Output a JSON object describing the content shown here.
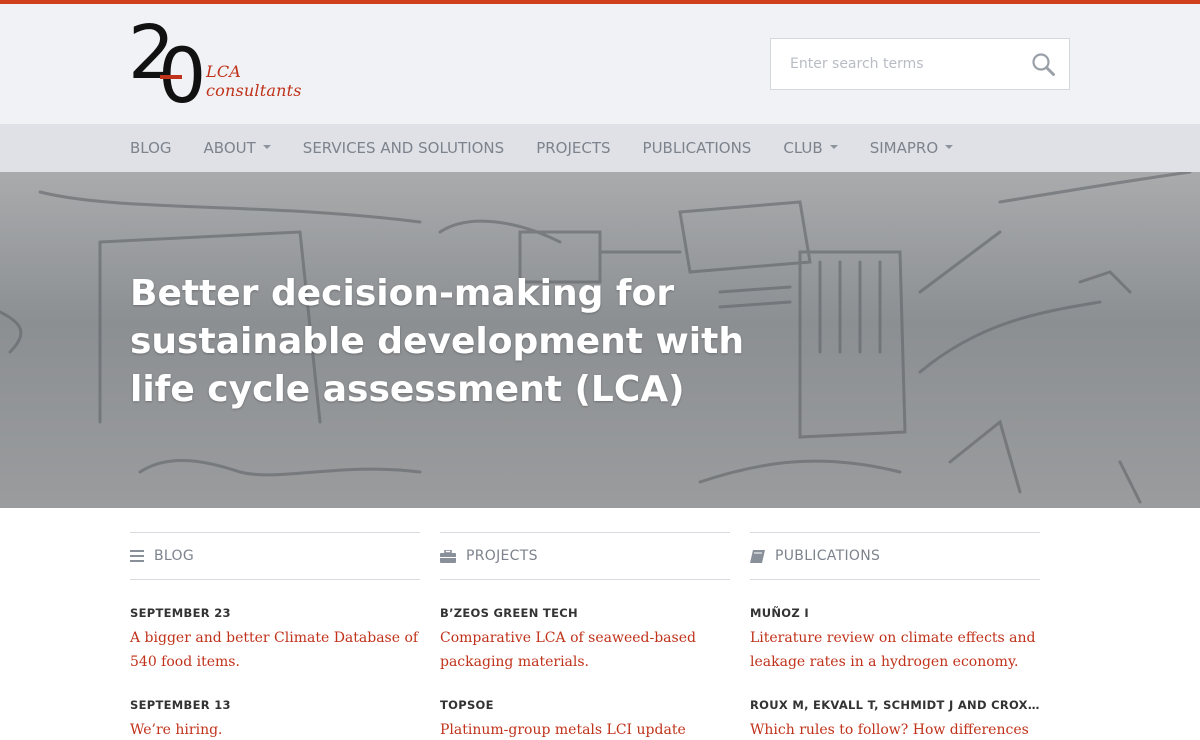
{
  "brand": {
    "logo_digit_two": "2",
    "logo_digit_zero": "0",
    "tagline": "LCA consultants",
    "accent_color": "#d0401c",
    "link_color": "#c0321a"
  },
  "search": {
    "placeholder": "Enter search terms",
    "icon": "search-icon"
  },
  "nav": {
    "items": [
      {
        "label": "BLOG",
        "dropdown": false
      },
      {
        "label": "ABOUT",
        "dropdown": true
      },
      {
        "label": "SERVICES AND SOLUTIONS",
        "dropdown": false
      },
      {
        "label": "PROJECTS",
        "dropdown": false
      },
      {
        "label": "PUBLICATIONS",
        "dropdown": false
      },
      {
        "label": "CLUB",
        "dropdown": true
      },
      {
        "label": "SIMAPRO",
        "dropdown": true
      }
    ]
  },
  "hero": {
    "headline": "Better decision-making for sustainable development with life cycle assessment (LCA)"
  },
  "sections": {
    "blog": {
      "heading": "BLOG",
      "icon": "list-icon",
      "entries": [
        {
          "meta": "SEPTEMBER 23",
          "title": "A bigger and better Climate Database of 540 food items."
        },
        {
          "meta": "SEPTEMBER 13",
          "title": "We’re hiring."
        }
      ]
    },
    "projects": {
      "heading": "PROJECTS",
      "icon": "briefcase-icon",
      "entries": [
        {
          "meta": "B’ZEOS GREEN TECH",
          "title": "Comparative LCA of seaweed-based packaging materials."
        },
        {
          "meta": "TOPSOE",
          "title": "Platinum-group metals LCI update"
        }
      ]
    },
    "publications": {
      "heading": "PUBLICATIONS",
      "icon": "book-icon",
      "entries": [
        {
          "meta": "MUÑOZ I",
          "title": "Literature review on climate effects and leakage rates in a hydrogen economy."
        },
        {
          "meta": "ROUX M, EKVALL T, SCHMIDT J AND CROXAT...",
          "title": "Which rules to follow? How differences in"
        }
      ]
    }
  }
}
